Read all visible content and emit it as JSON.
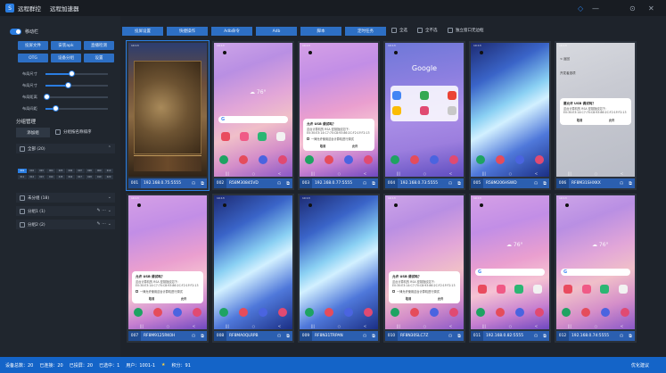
{
  "titlebar": {
    "logo": "S",
    "tabs": [
      "远程群控",
      "远程加速器"
    ],
    "controls": [
      "—",
      "◇",
      "⊙",
      "✕"
    ]
  },
  "left": {
    "toggle_label": "移动栏",
    "buttons": [
      "投屏文件",
      "安装apk",
      "直播检测",
      "OTG",
      "设备分组",
      "设置"
    ],
    "sliders": [
      {
        "label": "布局尺寸",
        "value": 0.42
      },
      {
        "label": "布局尺寸",
        "value": 0.36
      },
      {
        "label": "布局距离",
        "value": 0.02
      },
      {
        "label": "布局间距",
        "value": 0.16
      }
    ],
    "section_title": "分组管理",
    "new_group_button": "添加组",
    "sort_label": "分组按名称排序",
    "groups": [
      {
        "name": "全部 (20)",
        "tail": "⌃"
      },
      {
        "name": "未分组 (18)",
        "tail": "⌄"
      },
      {
        "name": "分组1 (1)",
        "tail": "✎ ⋯ ⌄"
      },
      {
        "name": "分组2 (2)",
        "tail": "✎ ⋯ ⌄"
      }
    ],
    "device_chips": [
      "001",
      "002",
      "003",
      "004",
      "005",
      "006",
      "007",
      "008",
      "009",
      "010",
      "011",
      "012",
      "013",
      "014",
      "015",
      "016",
      "017",
      "018",
      "019",
      "020"
    ]
  },
  "toolbar": {
    "buttons": [
      "投屏设置",
      "快捷操作",
      "Adb命令",
      "Adb",
      "脚本",
      "定时任务"
    ],
    "checks": [
      "全选",
      "全不选",
      "独立窗口无边框"
    ]
  },
  "devices": [
    {
      "num": "001",
      "name": "192.168.0.75:5555",
      "wall": "wall-game",
      "kind": "game",
      "selected": true
    },
    {
      "num": "002",
      "name": "R58M30845VD",
      "wall": "wall-a",
      "kind": "home"
    },
    {
      "num": "003",
      "name": "192.168.0.77:5555",
      "wall": "wall-b",
      "kind": "dialog"
    },
    {
      "num": "004",
      "name": "192.168.0.73:5555",
      "wall": "wall-c",
      "kind": "google"
    },
    {
      "num": "005",
      "name": "R58M206HSWD",
      "wall": "wall-e",
      "kind": "dock"
    },
    {
      "num": "006",
      "name": "RF8M31SHXKX",
      "wall": "wall-d",
      "kind": "settings"
    },
    {
      "num": "007",
      "name": "RF8M9125RK0H",
      "wall": "wall-b",
      "kind": "dialog"
    },
    {
      "num": "008",
      "name": "RF8MA0QLRPB",
      "wall": "wall-e",
      "kind": "dock"
    },
    {
      "num": "009",
      "name": "RF8N31TRPAN",
      "wall": "wall-e",
      "kind": "dock"
    },
    {
      "num": "010",
      "name": "RF8N30SLC7Z",
      "wall": "wall-a",
      "kind": "dialog"
    },
    {
      "num": "011",
      "name": "192.168.0.82:5555",
      "wall": "wall-b",
      "kind": "home"
    },
    {
      "num": "012",
      "name": "192.168.0.74:5555",
      "wall": "wall-a",
      "kind": "home"
    }
  ],
  "dialog": {
    "title": "允许 USB 调试吗？",
    "line1": "这台计算机的 RSA 密钥指纹如下：",
    "line2": "E0:30:E3:14:C7:70:C8:93:86:2C:F2:1F:F2:13",
    "check": "一律允许使用这台计算机进行调试",
    "cancel": "取消",
    "ok": "允许"
  },
  "google_label": "Google",
  "settings": {
    "back": "< 返回",
    "header": "开发者选项",
    "title": "要允许 USB 调试吗？",
    "cancel": "取消",
    "ok": "允许"
  },
  "phone_time": "10:13",
  "weather": "☁ 76°",
  "nav_keys": [
    "|||",
    "○",
    "<"
  ],
  "tile_icons": {
    "share": "⚇",
    "window": "⧉"
  },
  "statusbar": {
    "items": [
      "设备总数：20",
      "已连接：20",
      "已投屏：20",
      "已选中：1",
      "用户：1001-1",
      "★",
      "积分：91"
    ],
    "right": "优化建议"
  },
  "colors": {
    "accent": "#2a7de1",
    "status_strip": "#1464c8",
    "button": "#2d6fc4"
  }
}
